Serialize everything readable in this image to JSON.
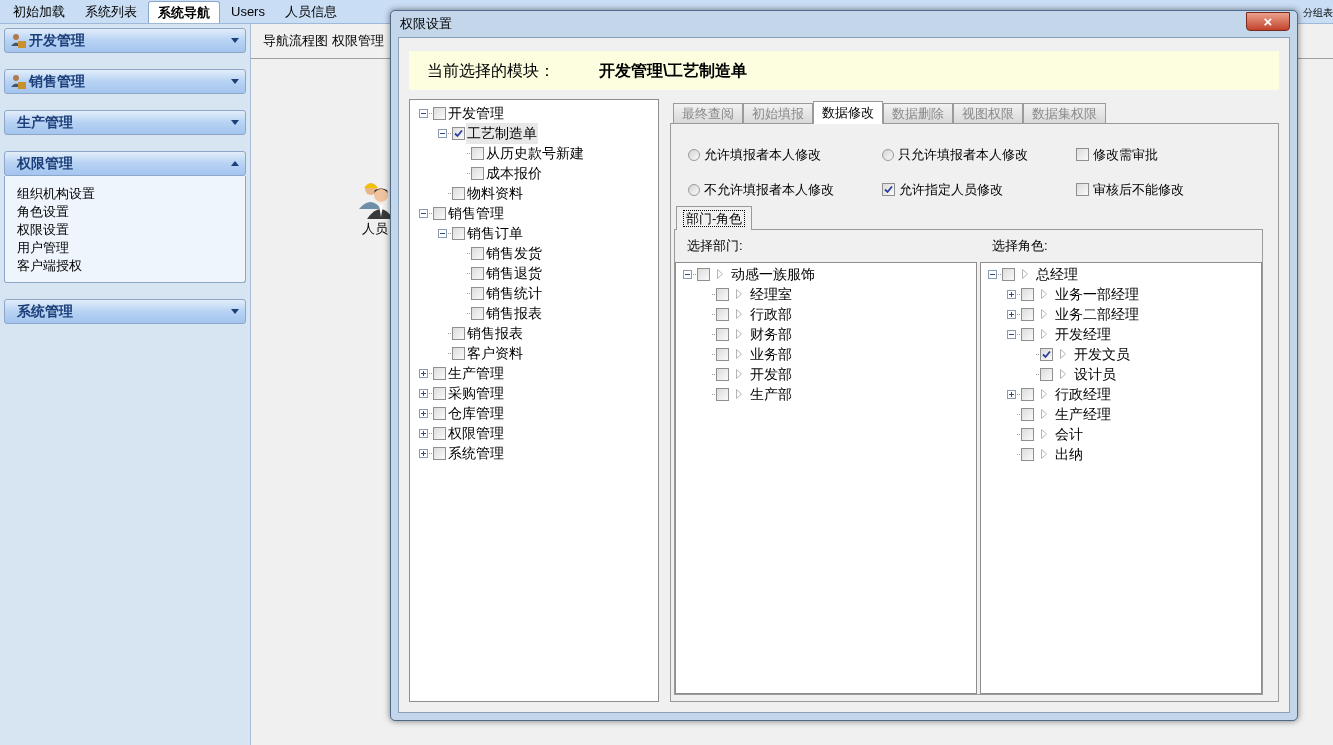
{
  "top_tabs": [
    {
      "label": "初始加载",
      "selected": false
    },
    {
      "label": "系统列表",
      "selected": false
    },
    {
      "label": "系统导航",
      "selected": true
    },
    {
      "label": "Users",
      "selected": false
    },
    {
      "label": "人员信息",
      "selected": false
    },
    {
      "label": "分组表",
      "selected": false
    }
  ],
  "sidebar": [
    {
      "title": "开发管理",
      "expanded": false,
      "kind": "icon"
    },
    {
      "title": "销售管理",
      "expanded": false,
      "kind": "icon"
    },
    {
      "title": "生产管理",
      "expanded": false,
      "kind": "plain"
    },
    {
      "title": "权限管理",
      "expanded": true,
      "kind": "plain",
      "items": [
        "组织机构设置",
        "角色设置",
        "权限设置",
        "用户管理",
        "客户端授权"
      ]
    },
    {
      "title": "系统管理",
      "expanded": false,
      "kind": "plain"
    }
  ],
  "breadcrumb": "导航流程图 权限管理",
  "desktop_icon": {
    "label": "人员"
  },
  "dialog": {
    "title": "权限设置",
    "close": "×",
    "banner_label": "当前选择的模块：",
    "banner_value": "开发管理\\工艺制造单",
    "module_tree": [
      {
        "label": "开发管理",
        "checked": false,
        "selected": false,
        "expanded": true,
        "children": [
          {
            "label": "工艺制造单",
            "checked": true,
            "selected": true,
            "expanded": true,
            "children": [
              {
                "label": "从历史款号新建",
                "checked": false,
                "selected": false
              },
              {
                "label": "成本报价",
                "checked": false,
                "selected": false
              }
            ]
          },
          {
            "label": "物料资料",
            "checked": false,
            "selected": false
          }
        ]
      },
      {
        "label": "销售管理",
        "checked": false,
        "selected": false,
        "expanded": true,
        "children": [
          {
            "label": "销售订单",
            "checked": false,
            "selected": false,
            "expanded": true,
            "children": [
              {
                "label": "销售发货",
                "checked": false,
                "selected": false
              },
              {
                "label": "销售退货",
                "checked": false,
                "selected": false
              },
              {
                "label": "销售统计",
                "checked": false,
                "selected": false
              },
              {
                "label": "销售报表",
                "checked": false,
                "selected": false
              }
            ]
          },
          {
            "label": "销售报表",
            "checked": false,
            "selected": false
          },
          {
            "label": "客户资料",
            "checked": false,
            "selected": false
          }
        ]
      },
      {
        "label": "生产管理",
        "checked": false,
        "selected": false,
        "expanded": false
      },
      {
        "label": "采购管理",
        "checked": false,
        "selected": false,
        "expanded": false
      },
      {
        "label": "仓库管理",
        "checked": false,
        "selected": false,
        "expanded": false
      },
      {
        "label": "权限管理",
        "checked": false,
        "selected": false,
        "expanded": false
      },
      {
        "label": "系统管理",
        "checked": false,
        "selected": false,
        "expanded": false
      }
    ],
    "perm_tabs": [
      {
        "label": "最终查阅",
        "selected": false
      },
      {
        "label": "初始填报",
        "selected": false
      },
      {
        "label": "数据修改",
        "selected": true
      },
      {
        "label": "数据删除",
        "selected": false
      },
      {
        "label": "视图权限",
        "selected": false
      },
      {
        "label": "数据集权限",
        "selected": false
      }
    ],
    "options": [
      {
        "kind": "radio",
        "label": "允许填报者本人修改",
        "checked": false
      },
      {
        "kind": "radio",
        "label": "只允许填报者本人修改",
        "checked": false
      },
      {
        "kind": "checkbox",
        "label": "修改需审批",
        "checked": false
      },
      {
        "kind": "radio",
        "label": "不允许填报者本人修改",
        "checked": false
      },
      {
        "kind": "checkbox",
        "label": "允许指定人员修改",
        "checked": true
      },
      {
        "kind": "checkbox",
        "label": "审核后不能修改",
        "checked": false
      }
    ],
    "sub_tab": {
      "label": "部门-角色",
      "selected": true
    },
    "dept_heading": "选择部门:",
    "role_heading": "选择角色:",
    "dept_tree": [
      {
        "label": "动感一族服饰",
        "checked": false,
        "expanded": true,
        "children": [
          {
            "label": "经理室",
            "checked": false
          },
          {
            "label": "行政部",
            "checked": false
          },
          {
            "label": "财务部",
            "checked": false
          },
          {
            "label": "业务部",
            "checked": false
          },
          {
            "label": "开发部",
            "checked": false
          },
          {
            "label": "生产部",
            "checked": false
          }
        ]
      }
    ],
    "role_tree": [
      {
        "label": "总经理",
        "checked": false,
        "expanded": true,
        "children": [
          {
            "label": "业务一部经理",
            "checked": false,
            "expanded": false
          },
          {
            "label": "业务二部经理",
            "checked": false,
            "expanded": false
          },
          {
            "label": "开发经理",
            "checked": false,
            "expanded": true,
            "children": [
              {
                "label": "开发文员",
                "checked": true
              },
              {
                "label": "设计员",
                "checked": false
              }
            ]
          },
          {
            "label": "行政经理",
            "checked": false,
            "expanded": false
          },
          {
            "label": "生产经理",
            "checked": false
          },
          {
            "label": "会计",
            "checked": false
          },
          {
            "label": "出纳",
            "checked": false
          }
        ]
      }
    ]
  }
}
